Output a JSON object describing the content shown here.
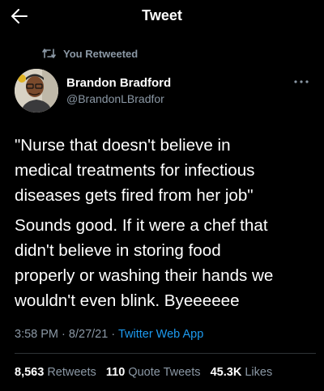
{
  "header": {
    "title": "Tweet",
    "back_icon": "arrow-left-icon"
  },
  "retweet_context": {
    "icon": "retweet-icon",
    "label": "You Retweeted"
  },
  "tweet": {
    "author": {
      "name": "Brandon Bradford",
      "handle": "@BrandonLBradfor"
    },
    "more_icon": "more-options-icon",
    "text_lines": [
      "\"Nurse that doesn't believe in",
      "medical treatments for infectious",
      "diseases gets fired from her job\"",
      "Sounds good. If it were a chef that",
      "didn't believe in storing food",
      "properly or washing their hands we",
      "wouldn't even blink. Byeeeeee"
    ],
    "time": "3:58 PM",
    "date": "8/27/21",
    "separator": "·",
    "source": "Twitter Web App"
  },
  "stats": {
    "retweets": {
      "count": "8,563",
      "label": "Retweets"
    },
    "quote_tweets": {
      "count": "110",
      "label": "Quote Tweets"
    },
    "likes": {
      "count": "45.3K",
      "label": "Likes"
    }
  },
  "colors": {
    "background": "#000000",
    "text_primary": "#ffffff",
    "text_secondary": "#8b98a5",
    "link": "#1d9bf0",
    "divider": "#2f3336"
  }
}
